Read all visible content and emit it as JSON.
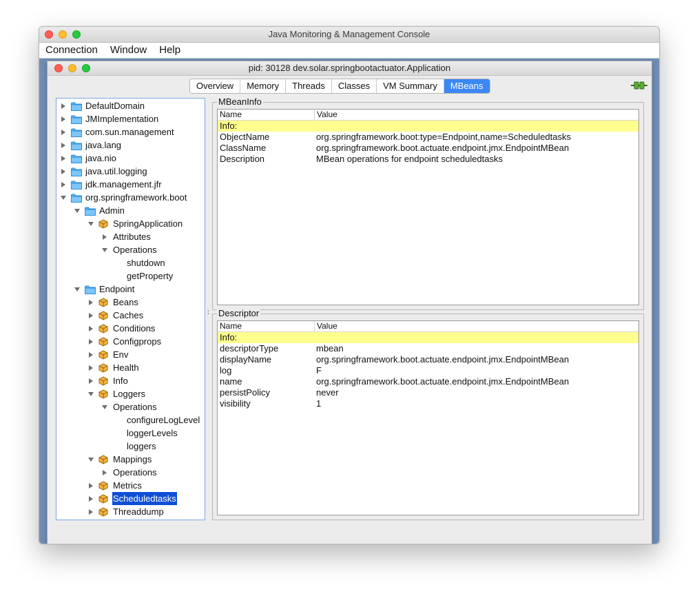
{
  "outer_window": {
    "title": "Java Monitoring & Management Console"
  },
  "menu": [
    "Connection",
    "Window",
    "Help"
  ],
  "inner_window": {
    "title": "pid: 30128 dev.solar.springbootactuator.Application"
  },
  "tabs": [
    "Overview",
    "Memory",
    "Threads",
    "Classes",
    "VM Summary",
    "MBeans"
  ],
  "active_tab": "MBeans",
  "tree": [
    {
      "label": "DefaultDomain",
      "depth": 0,
      "kind": "folder",
      "expanded": false
    },
    {
      "label": "JMImplementation",
      "depth": 0,
      "kind": "folder",
      "expanded": false
    },
    {
      "label": "com.sun.management",
      "depth": 0,
      "kind": "folder",
      "expanded": false
    },
    {
      "label": "java.lang",
      "depth": 0,
      "kind": "folder",
      "expanded": false
    },
    {
      "label": "java.nio",
      "depth": 0,
      "kind": "folder",
      "expanded": false
    },
    {
      "label": "java.util.logging",
      "depth": 0,
      "kind": "folder",
      "expanded": false
    },
    {
      "label": "jdk.management.jfr",
      "depth": 0,
      "kind": "folder",
      "expanded": false
    },
    {
      "label": "org.springframework.boot",
      "depth": 0,
      "kind": "folder",
      "expanded": true
    },
    {
      "label": "Admin",
      "depth": 1,
      "kind": "folder",
      "expanded": true
    },
    {
      "label": "SpringApplication",
      "depth": 2,
      "kind": "bean",
      "expanded": true
    },
    {
      "label": "Attributes",
      "depth": 3,
      "kind": "node",
      "expanded": false
    },
    {
      "label": "Operations",
      "depth": 3,
      "kind": "node",
      "expanded": true
    },
    {
      "label": "shutdown",
      "depth": 4,
      "kind": "leaf"
    },
    {
      "label": "getProperty",
      "depth": 4,
      "kind": "leaf"
    },
    {
      "label": "Endpoint",
      "depth": 1,
      "kind": "folder",
      "expanded": true
    },
    {
      "label": "Beans",
      "depth": 2,
      "kind": "bean",
      "expanded": false
    },
    {
      "label": "Caches",
      "depth": 2,
      "kind": "bean",
      "expanded": false
    },
    {
      "label": "Conditions",
      "depth": 2,
      "kind": "bean",
      "expanded": false
    },
    {
      "label": "Configprops",
      "depth": 2,
      "kind": "bean",
      "expanded": false
    },
    {
      "label": "Env",
      "depth": 2,
      "kind": "bean",
      "expanded": false
    },
    {
      "label": "Health",
      "depth": 2,
      "kind": "bean",
      "expanded": false
    },
    {
      "label": "Info",
      "depth": 2,
      "kind": "bean",
      "expanded": false
    },
    {
      "label": "Loggers",
      "depth": 2,
      "kind": "bean",
      "expanded": true
    },
    {
      "label": "Operations",
      "depth": 3,
      "kind": "node",
      "expanded": true
    },
    {
      "label": "configureLogLevel",
      "depth": 4,
      "kind": "leaf"
    },
    {
      "label": "loggerLevels",
      "depth": 4,
      "kind": "leaf"
    },
    {
      "label": "loggers",
      "depth": 4,
      "kind": "leaf"
    },
    {
      "label": "Mappings",
      "depth": 2,
      "kind": "bean",
      "expanded": true
    },
    {
      "label": "Operations",
      "depth": 3,
      "kind": "node",
      "expanded": false
    },
    {
      "label": "Metrics",
      "depth": 2,
      "kind": "bean",
      "expanded": false
    },
    {
      "label": "Scheduledtasks",
      "depth": 2,
      "kind": "bean",
      "expanded": false,
      "selected": true
    },
    {
      "label": "Threaddump",
      "depth": 2,
      "kind": "bean",
      "expanded": false
    }
  ],
  "mbeaninfo": {
    "title": "MBeanInfo",
    "columns": [
      "Name",
      "Value"
    ],
    "rows": [
      {
        "name": "Info:",
        "value": "",
        "highlight": true
      },
      {
        "name": "ObjectName",
        "value": "org.springframework.boot:type=Endpoint,name=Scheduledtasks"
      },
      {
        "name": "ClassName",
        "value": "org.springframework.boot.actuate.endpoint.jmx.EndpointMBean"
      },
      {
        "name": "Description",
        "value": "MBean operations for endpoint scheduledtasks"
      }
    ]
  },
  "descriptor": {
    "title": "Descriptor",
    "columns": [
      "Name",
      "Value"
    ],
    "rows": [
      {
        "name": "Info:",
        "value": "",
        "highlight": true
      },
      {
        "name": "descriptorType",
        "value": "mbean"
      },
      {
        "name": "displayName",
        "value": "org.springframework.boot.actuate.endpoint.jmx.EndpointMBean"
      },
      {
        "name": "log",
        "value": "F"
      },
      {
        "name": "name",
        "value": "org.springframework.boot.actuate.endpoint.jmx.EndpointMBean"
      },
      {
        "name": "persistPolicy",
        "value": "never"
      },
      {
        "name": "visibility",
        "value": "1"
      }
    ]
  },
  "colors": {
    "selection": "#0f4fd6",
    "tab_active": "#3b88f5",
    "info_row": "#ffff8e",
    "folder": "#4aa8f0"
  }
}
